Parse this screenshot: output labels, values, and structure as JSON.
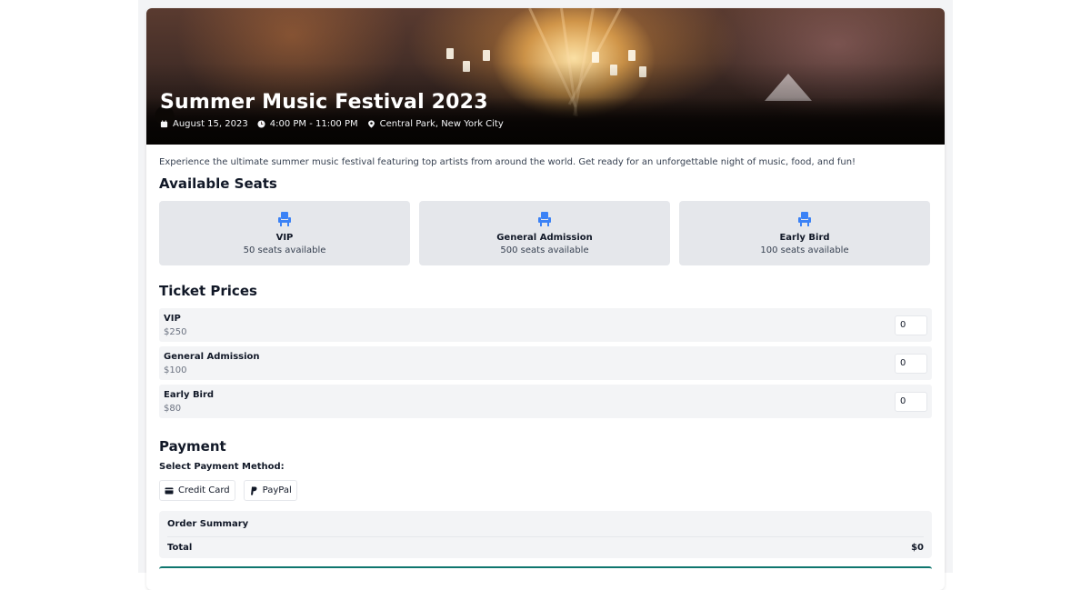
{
  "event": {
    "title": "Summer Music Festival 2023",
    "date": "August 15, 2023",
    "time": "4:00 PM - 11:00 PM",
    "location": "Central Park, New York City",
    "description": "Experience the ultimate summer music festival featuring top artists from around the world. Get ready for an unforgettable night of music, food, and fun!"
  },
  "seats": {
    "heading": "Available Seats",
    "icon": "seat-icon",
    "items": [
      {
        "name": "VIP",
        "availability": "50 seats available"
      },
      {
        "name": "General Admission",
        "availability": "500 seats available"
      },
      {
        "name": "Early Bird",
        "availability": "100 seats available"
      }
    ]
  },
  "tickets": {
    "heading": "Ticket Prices",
    "items": [
      {
        "name": "VIP",
        "price": "$250",
        "quantity": "0"
      },
      {
        "name": "General Admission",
        "price": "$100",
        "quantity": "0"
      },
      {
        "name": "Early Bird",
        "price": "$80",
        "quantity": "0"
      }
    ]
  },
  "payment": {
    "heading": "Payment",
    "method_label": "Select Payment Method:",
    "methods": [
      {
        "label": "Credit Card",
        "icon": "credit-card-icon"
      },
      {
        "label": "PayPal",
        "icon": "paypal-icon"
      }
    ]
  },
  "summary": {
    "title": "Order Summary",
    "total_label": "Total",
    "total_value": "$0"
  },
  "colors": {
    "accent": "#3b82f6",
    "page_background": "#f3f4f6",
    "seat_card": "#e5e7eb"
  }
}
